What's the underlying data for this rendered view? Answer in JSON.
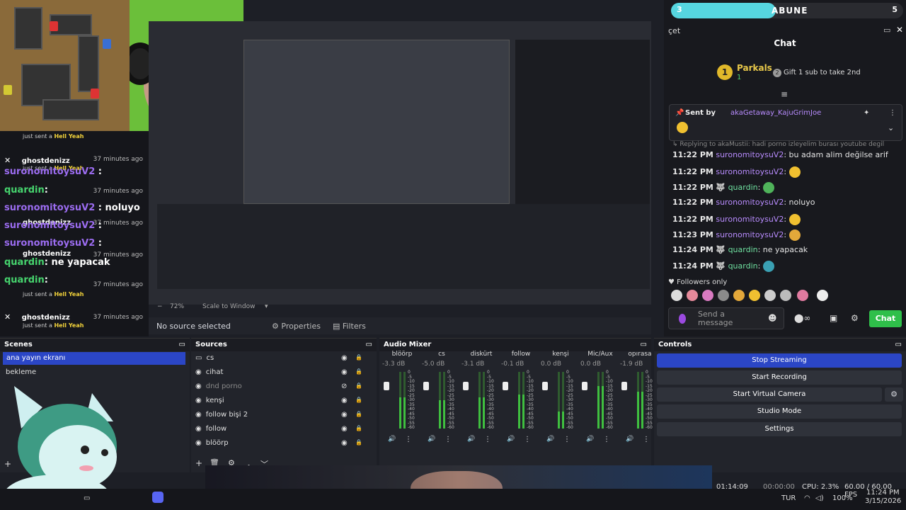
{
  "left_chat": {
    "items": [
      {
        "name": "ghostdenizz",
        "time": "37 minutes ago",
        "sub_prefix": "just sent a",
        "sub_highlight": "Hell Yeah"
      },
      {
        "name": "ghostdenizz",
        "time": "37 minutes ago",
        "sub_prefix": "just sent a",
        "sub_highlight": "Hell Yeah"
      },
      {
        "name": "ghostdenizz",
        "time": "37 minutes ago",
        "sub_prefix": "just sent a",
        "sub_highlight": "Hell Yeah"
      },
      {
        "name": "ghostdenizz",
        "time": "37 minutes ago",
        "sub_prefix": "just sent a",
        "sub_highlight": "Hell Yeah"
      },
      {
        "name": "ghostdenizz",
        "time": "37 minutes ago",
        "sub_prefix": "just sent a",
        "sub_highlight": "Hell Yeah"
      },
      {
        "name": "ghostdenizz",
        "time": "37 minutes ago",
        "sub_prefix": "just sent a",
        "sub_highlight": "Hell Yeah"
      }
    ],
    "big_lines": [
      {
        "user": "suronomitoysuV2",
        "sep": " :",
        "text": ""
      },
      {
        "user": "quardin",
        "sep": ":",
        "text": ""
      },
      {
        "user": "suronomitoysuV2",
        "sep": " :",
        "text": "noluyo"
      },
      {
        "user": "suronomitoysuV2",
        "sep": " :",
        "text": ""
      },
      {
        "user": "suronomitoysuV2",
        "sep": " :",
        "text": ""
      },
      {
        "user": "quardin",
        "sep": ":",
        "text": " ne yapacak"
      },
      {
        "user": "quardin",
        "sep": ":",
        "text": ""
      }
    ]
  },
  "preview": {
    "zoom": "72%",
    "scale_mode": "Scale to Window",
    "no_source": "No source selected",
    "properties_label": "Properties",
    "filters_label": "Filters"
  },
  "right_panel": {
    "progress": {
      "left": "3",
      "label": "ABUNE",
      "right": "5",
      "fraction": 0.45
    },
    "window_title": "çet",
    "chat_title": "Chat",
    "leader": {
      "rank": "1",
      "name": "Parkals",
      "count": "1",
      "goal_rank": "2",
      "goal_text": "Gift 1 sub to take 2nd"
    },
    "pinned": {
      "prefix": "Sent by",
      "user": "akaGetaway_KajuGrimJoe"
    },
    "reply_preview": "Replying to akaMustii: hadi porno izleyelim burası youtube degil",
    "messages": [
      {
        "time": "11:22 PM",
        "user": "suronomitoysuV2",
        "text": ": bu adam alim değilse arif",
        "color": "purple"
      },
      {
        "time": "11:22 PM",
        "user": "suronomitoysuV2",
        "text": ":",
        "color": "purple"
      },
      {
        "time": "11:22 PM",
        "user": "quardin",
        "text": ":",
        "color": "green"
      },
      {
        "time": "11:22 PM",
        "user": "suronomitoysuV2",
        "text": ": noluyo",
        "color": "purple"
      },
      {
        "time": "11:22 PM",
        "user": "suronomitoysuV2",
        "text": ":",
        "color": "purple"
      },
      {
        "time": "11:23 PM",
        "user": "suronomitoysuV2",
        "text": ":",
        "color": "purple"
      },
      {
        "time": "11:24 PM",
        "user": "quardin",
        "text": ": ne yapacak",
        "color": "green"
      },
      {
        "time": "11:24 PM",
        "user": "quardin",
        "text": ":",
        "color": "green"
      }
    ],
    "followers_only": "Followers only",
    "send_placeholder": "Send a message",
    "chat_button": "Chat"
  },
  "scenes": {
    "title": "Scenes",
    "items": [
      "ana yayın ekranı",
      "bekleme"
    ]
  },
  "sources": {
    "title": "Sources",
    "items": [
      "cs",
      "cihat",
      "dnd porno",
      "kenşi",
      "follow bişi 2",
      "follow",
      "blöörp"
    ]
  },
  "mixer": {
    "title": "Audio Mixer",
    "channels": [
      {
        "name": "blöörp",
        "db": "-3.3 dB",
        "level": 0.55
      },
      {
        "name": "cs",
        "db": "-5.0 dB",
        "level": 0.5
      },
      {
        "name": "diskürt",
        "db": "-3.1 dB",
        "level": 0.55
      },
      {
        "name": "follow",
        "db": "-0.1 dB",
        "level": 0.6
      },
      {
        "name": "kenşi",
        "db": "0.0 dB",
        "level": 0.3
      },
      {
        "name": "Mic/Aux",
        "db": "0.0 dB",
        "level": 0.75
      },
      {
        "name": "opırasa",
        "db": "-1.9 dB",
        "level": 0.65
      }
    ],
    "scale": [
      "0",
      "-5",
      "-10",
      "-15",
      "-20",
      "-25",
      "-30",
      "-35",
      "-40",
      "-45",
      "-50",
      "-55",
      "-60"
    ]
  },
  "controls": {
    "title": "Controls",
    "buttons": [
      "Stop Streaming",
      "Start Recording",
      "Start Virtual Camera",
      "Studio Mode",
      "Settings"
    ]
  },
  "statusbar": {
    "live_time": "01:14:09",
    "rec_time": "00:00:00",
    "cpu": "CPU: 2.3%",
    "fps": "60.00 / 60.00 FPS",
    "lang": "TUR",
    "battery": "100%",
    "clock": "11:24 PM",
    "date": "3/15/2026"
  },
  "colors": {
    "accent_blue": "#2b46c6",
    "chat_green": "#2fbf4a",
    "progress_cyan": "#56d6e0",
    "username_purple": "#b98cff"
  }
}
